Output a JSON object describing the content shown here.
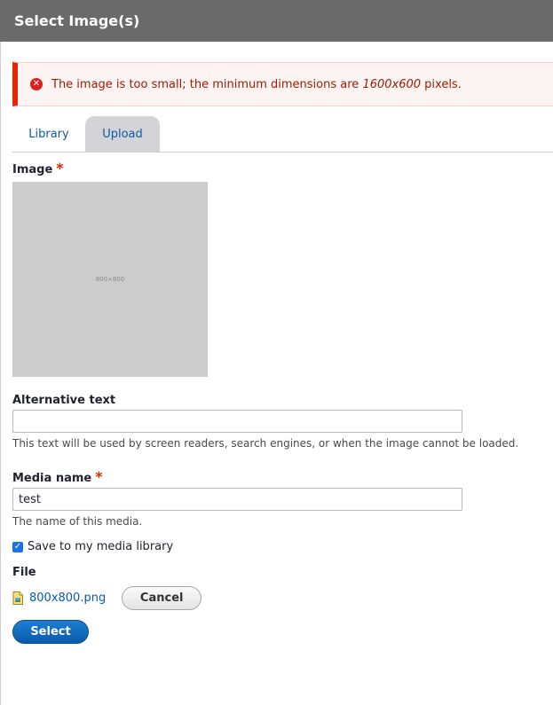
{
  "dialog": {
    "title": "Select Image(s)"
  },
  "error": {
    "text_before": "The image is too small; the minimum dimensions are ",
    "dimensions": "1600x600",
    "text_after": " pixels."
  },
  "tabs": [
    {
      "label": "Library",
      "active": false
    },
    {
      "label": "Upload",
      "active": true
    }
  ],
  "image_field": {
    "label": "Image",
    "required_mark": "*",
    "preview_text": "800×800"
  },
  "alt_text": {
    "label": "Alternative text",
    "value": "",
    "description": "This text will be used by screen readers, search engines, or when the image cannot be loaded."
  },
  "media_name": {
    "label": "Media name",
    "required_mark": "*",
    "value": "test",
    "description": "The name of this media."
  },
  "save_library": {
    "label": "Save to my media library",
    "checked": true
  },
  "file": {
    "label": "File",
    "filename": "800x800.png",
    "cancel_label": "Cancel"
  },
  "actions": {
    "select_label": "Select"
  },
  "colors": {
    "titlebar": "#6a6a6a",
    "error_accent": "#e62600",
    "link": "#0b5ba8",
    "primary_button": "#0a5ba8"
  }
}
